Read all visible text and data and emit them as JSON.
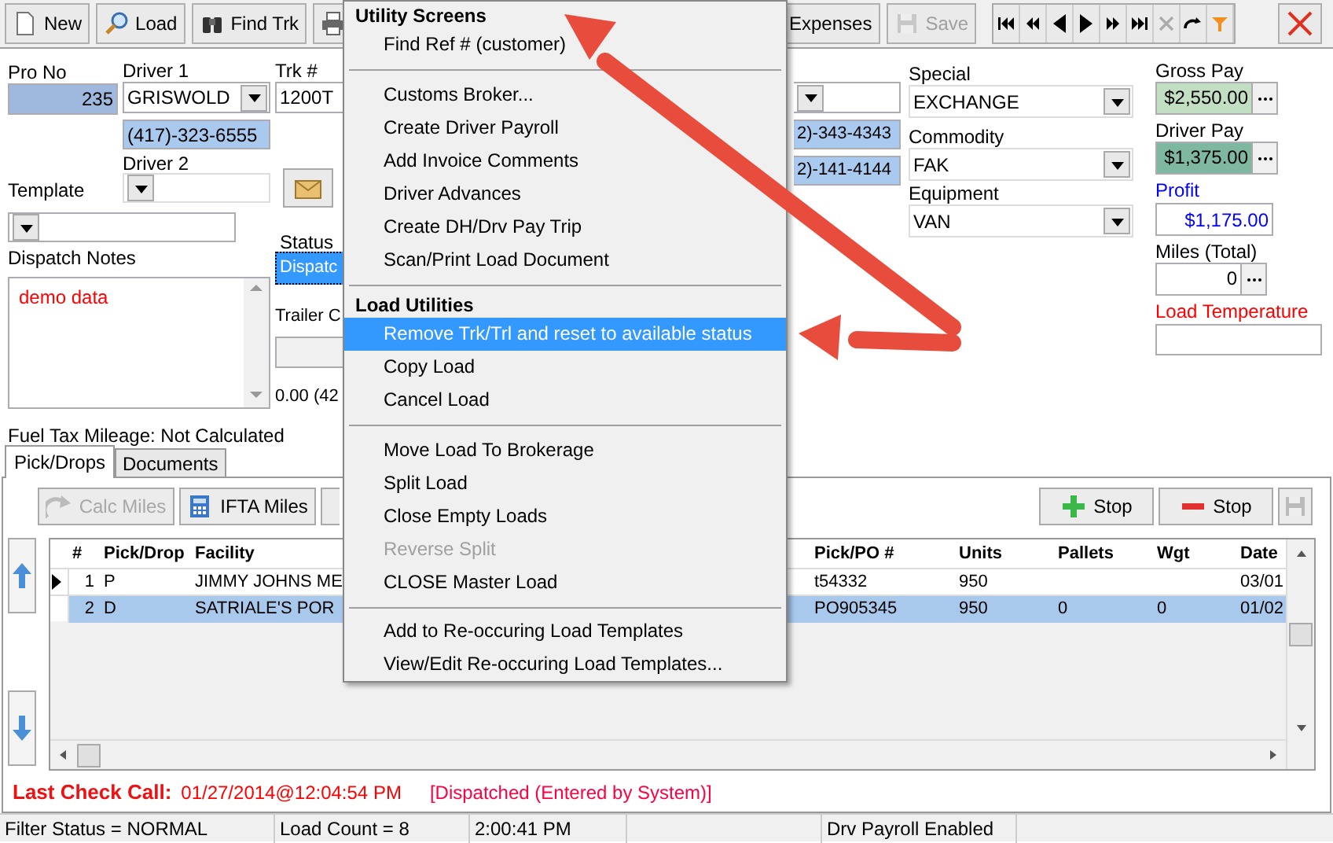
{
  "toolbar": {
    "buttons": [
      {
        "kind": "new",
        "label": "New",
        "disabled": false
      },
      {
        "kind": "load",
        "label": "Load",
        "disabled": false
      },
      {
        "kind": "find",
        "label": "Find Trk",
        "disabled": false
      },
      {
        "kind": "print"
      }
    ],
    "right_buttons": [
      {
        "kind": "expenses",
        "label": "Expenses",
        "disabled": false
      },
      {
        "kind": "save",
        "label": "Save",
        "disabled": true
      }
    ]
  },
  "form": {
    "pro_no": {
      "label": "Pro No",
      "value": "235"
    },
    "driver_1": {
      "label": "Driver 1",
      "value": "GRISWOLD",
      "phone": "(417)-323-6555"
    },
    "driver_2": {
      "label": "Driver 2"
    },
    "template": {
      "label": "Template"
    },
    "dispatch_notes": {
      "label": "Dispatch Notes",
      "value": "demo data"
    },
    "truck": {
      "label": "Trk #",
      "value": "1200T"
    },
    "status": {
      "label": "Status",
      "value": "Dispatc"
    },
    "trailer": {
      "label": "Trailer C"
    },
    "trailer_reading": "0.00 (42",
    "fuel_tax_mileage": "Fuel Tax Mileage:  Not Calculated",
    "phone_fragments": [
      "2)-343-4343",
      "2)-141-4144"
    ],
    "special": {
      "label": "Special",
      "value": "EXCHANGE"
    },
    "commodity": {
      "label": "Commodity",
      "value": "FAK"
    },
    "equipment": {
      "label": "Equipment",
      "value": "VAN"
    },
    "gross_pay": {
      "label": "Gross Pay",
      "value": "$2,550.00"
    },
    "driver_pay": {
      "label": "Driver Pay",
      "value": "$1,375.00"
    },
    "profit": {
      "label": "Profit",
      "value": "$1,175.00"
    },
    "miles": {
      "label": "Miles (Total)",
      "value": "0"
    },
    "load_temperature": {
      "label": "Load Temperature"
    }
  },
  "tabs": [
    {
      "label": "Pick/Drops",
      "selected": true
    },
    {
      "label": "Documents",
      "selected": false
    }
  ],
  "stop_toolbar": {
    "buttons": [
      {
        "kind": "calc",
        "label": "Calc Miles",
        "disabled": true
      },
      {
        "kind": "ifta",
        "label": "IFTA Miles",
        "disabled": false
      }
    ],
    "right_buttons": [
      {
        "kind": "add",
        "label": "Stop"
      },
      {
        "kind": "remove",
        "label": "Stop"
      }
    ]
  },
  "grid": {
    "columns": [
      "#",
      "Pick/Drop",
      "Facility",
      "Pick/PO #",
      "Units",
      "Pallets",
      "Wgt",
      "Date"
    ],
    "rows": [
      {
        "number": "1",
        "type": "P",
        "facility": "JIMMY JOHNS ME",
        "po": "t54332",
        "units": "950",
        "date": "03/01",
        "current": true,
        "selected": false
      },
      {
        "number": "2",
        "type": "D",
        "facility": "SATRIALE'S POR",
        "po": "PO905345",
        "units": "950",
        "pallets": "0",
        "wgt": "0",
        "date": "01/02",
        "current": false,
        "selected": true
      }
    ]
  },
  "check_call": {
    "label": "Last Check Call:",
    "value": "01/27/2014@12:04:54 PM",
    "status": "[Dispatched (Entered by System)]"
  },
  "status_bar": [
    "Filter Status = NORMAL",
    "Load Count = 8",
    "2:00:41 PM",
    "Drv Payroll Enabled"
  ],
  "menu": {
    "entries": [
      {
        "kind": "header",
        "label": "Utility Screens"
      },
      {
        "kind": "item",
        "label": "Find Ref # (customer)",
        "selected": false,
        "disabled": false
      },
      {
        "kind": "separator"
      },
      {
        "kind": "item",
        "label": "Customs Broker...",
        "selected": false,
        "disabled": false
      },
      {
        "kind": "item",
        "label": "Create Driver Payroll",
        "selected": false,
        "disabled": false
      },
      {
        "kind": "item",
        "label": "Add Invoice Comments",
        "selected": false,
        "disabled": false
      },
      {
        "kind": "item",
        "label": "Driver Advances",
        "selected": false,
        "disabled": false
      },
      {
        "kind": "item",
        "label": "Create DH/Drv Pay Trip",
        "selected": false,
        "disabled": false
      },
      {
        "kind": "item",
        "label": "Scan/Print Load Document",
        "selected": false,
        "disabled": false
      },
      {
        "kind": "separator"
      },
      {
        "kind": "header",
        "label": "Load Utilities"
      },
      {
        "kind": "item",
        "label": "Remove Trk/Trl and reset to available status",
        "selected": true,
        "disabled": false
      },
      {
        "kind": "item",
        "label": "Copy Load",
        "selected": false,
        "disabled": false
      },
      {
        "kind": "item",
        "label": "Cancel Load",
        "selected": false,
        "disabled": false
      },
      {
        "kind": "separator"
      },
      {
        "kind": "item",
        "label": "Move Load To Brokerage",
        "selected": false,
        "disabled": false
      },
      {
        "kind": "item",
        "label": "Split Load",
        "selected": false,
        "disabled": false
      },
      {
        "kind": "item",
        "label": "Close Empty Loads",
        "selected": false,
        "disabled": false
      },
      {
        "kind": "item",
        "label": "Reverse Split",
        "selected": false,
        "disabled": true
      },
      {
        "kind": "item",
        "label": "CLOSE Master Load",
        "selected": false,
        "disabled": false
      },
      {
        "kind": "separator"
      },
      {
        "kind": "item",
        "label": "Add to Re-occuring Load Templates",
        "selected": false,
        "disabled": false
      },
      {
        "kind": "item",
        "label": "View/Edit Re-occuring Load Templates...",
        "selected": false,
        "disabled": false
      }
    ]
  }
}
